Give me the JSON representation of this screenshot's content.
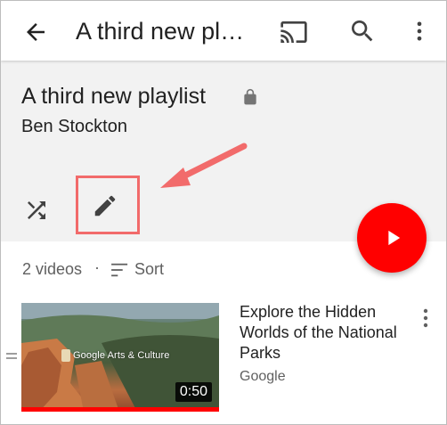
{
  "appbar": {
    "title": "A third new playlist",
    "back_icon": "arrow-back-icon",
    "cast_icon": "cast-icon",
    "search_icon": "search-icon",
    "more_icon": "more-vert-icon"
  },
  "playlist": {
    "title": "A third new playlist",
    "owner": "Ben Stockton",
    "privacy_icon": "lock-icon"
  },
  "actions": {
    "shuffle_icon": "shuffle-icon",
    "edit_icon": "pencil-icon",
    "play_icon": "play-icon",
    "highlight_color": "#f26b6b",
    "play_color": "#ff0000"
  },
  "list": {
    "count": "2 videos",
    "separator": "·",
    "sort_label": "Sort"
  },
  "videos": [
    {
      "title": "Explore the Hidden Worlds of the National Parks",
      "channel": "Google",
      "duration": "0:50",
      "thumbnail_caption": "Google Arts & Culture",
      "progress": 1.0
    }
  ]
}
